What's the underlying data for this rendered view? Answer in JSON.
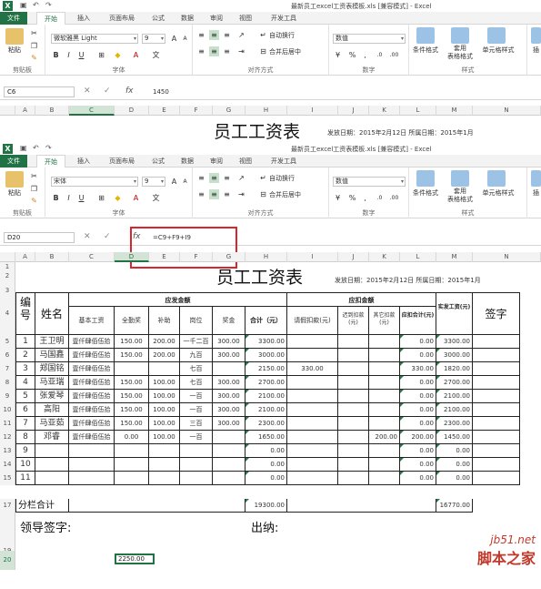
{
  "window": {
    "title": "最新员工excel工资表模板.xls  [兼容模式] - Excel",
    "app_icon": "X"
  },
  "tabs": [
    "文件",
    "开始",
    "插入",
    "页面布局",
    "公式",
    "数据",
    "审阅",
    "视图",
    "开发工具"
  ],
  "ribbon": {
    "paste_label": "粘贴",
    "clipboard_group": "剪贴板",
    "font_name_top": "微软雅黑 Light",
    "font_name_bottom": "宋体",
    "font_size": "9",
    "font_group": "字体",
    "align_group": "对齐方式",
    "wrap_text": "自动换行",
    "merge_center": "合并后居中",
    "number_format": "数值",
    "number_group": "数字",
    "cond_format": "条件格式",
    "table_format": "套用\n表格格式",
    "cell_style": "单元格样式",
    "insert_label": "插",
    "styles_group": "样式",
    "bold": "B",
    "italic": "I",
    "underline": "U",
    "font_letter": "A",
    "percent": "%",
    "thousands": ","
  },
  "formula_bar_top": {
    "name_box": "C6",
    "formula": "1450"
  },
  "formula_bar_bottom": {
    "name_box": "D20",
    "formula": "=C9+F9+I9"
  },
  "columns": [
    "A",
    "B",
    "C",
    "D",
    "E",
    "F",
    "G",
    "H",
    "I",
    "J",
    "K",
    "L",
    "M",
    "N"
  ],
  "sheet": {
    "title": "员工工资表",
    "date_line": "发放日期：2015年2月12日 所属日期：2015年1月",
    "hdr_no": "编号",
    "hdr_name": "姓名",
    "hdr_due": "应发金额",
    "hdr_deduct": "应扣金额",
    "hdr_net": "实发工资(元)",
    "hdr_sign": "签字",
    "sub": [
      "基本工资",
      "全勤奖",
      "补助",
      "岗位",
      "奖金",
      "合计（元）",
      "请假扣款(元)",
      "迟到扣款(元)",
      "其它扣款(元)",
      "应扣合计(元)"
    ],
    "rows": [
      {
        "row": "5",
        "no": "1",
        "name": "王卫明",
        "basic": "壹仟肆佰伍拾",
        "full": "150.00",
        "sub": "200.00",
        "post": "一千二百",
        "bonus": "300.00",
        "total": "3300.00",
        "leave": "",
        "late": "",
        "other": "",
        "ded": "0.00",
        "net": "3300.00"
      },
      {
        "row": "6",
        "no": "2",
        "name": "马国鑫",
        "basic": "壹仟肆佰伍拾",
        "full": "150.00",
        "sub": "200.00",
        "post": "九百",
        "bonus": "300.00",
        "total": "3000.00",
        "leave": "",
        "late": "",
        "other": "",
        "ded": "0.00",
        "net": "3000.00"
      },
      {
        "row": "7",
        "no": "3",
        "name": "郑国铭",
        "basic": "壹仟肆佰伍拾",
        "full": "",
        "sub": "",
        "post": "七百",
        "bonus": "",
        "total": "2150.00",
        "leave": "330.00",
        "late": "",
        "other": "",
        "ded": "330.00",
        "net": "1820.00"
      },
      {
        "row": "8",
        "no": "4",
        "name": "马亚瑞",
        "basic": "壹仟肆佰伍拾",
        "full": "150.00",
        "sub": "100.00",
        "post": "七百",
        "bonus": "300.00",
        "total": "2700.00",
        "leave": "",
        "late": "",
        "other": "",
        "ded": "0.00",
        "net": "2700.00"
      },
      {
        "row": "9",
        "no": "5",
        "name": "张爱琴",
        "basic": "壹仟肆佰伍拾",
        "full": "150.00",
        "sub": "100.00",
        "post": "一百",
        "bonus": "300.00",
        "total": "2100.00",
        "leave": "",
        "late": "",
        "other": "",
        "ded": "0.00",
        "net": "2100.00"
      },
      {
        "row": "10",
        "no": "6",
        "name": "高阳",
        "basic": "壹仟肆佰伍拾",
        "full": "150.00",
        "sub": "100.00",
        "post": "一百",
        "bonus": "300.00",
        "total": "2100.00",
        "leave": "",
        "late": "",
        "other": "",
        "ded": "0.00",
        "net": "2100.00"
      },
      {
        "row": "11",
        "no": "7",
        "name": "马亚茹",
        "basic": "壹仟肆佰伍拾",
        "full": "150.00",
        "sub": "100.00",
        "post": "三百",
        "bonus": "300.00",
        "total": "2300.00",
        "leave": "",
        "late": "",
        "other": "",
        "ded": "0.00",
        "net": "2300.00"
      },
      {
        "row": "12",
        "no": "8",
        "name": "邓睿",
        "basic": "壹仟肆佰伍拾",
        "full": "0.00",
        "sub": "100.00",
        "post": "一百",
        "bonus": "",
        "total": "1650.00",
        "leave": "",
        "late": "",
        "other": "200.00",
        "ded": "200.00",
        "net": "1450.00"
      },
      {
        "row": "13",
        "no": "9",
        "name": "",
        "basic": "",
        "full": "",
        "sub": "",
        "post": "",
        "bonus": "",
        "total": "0.00",
        "leave": "",
        "late": "",
        "other": "",
        "ded": "0.00",
        "net": "0.00"
      },
      {
        "row": "14",
        "no": "10",
        "name": "",
        "basic": "",
        "full": "",
        "sub": "",
        "post": "",
        "bonus": "",
        "total": "0.00",
        "leave": "",
        "late": "",
        "other": "",
        "ded": "0.00",
        "net": "0.00"
      },
      {
        "row": "15",
        "no": "11",
        "name": "",
        "basic": "",
        "full": "",
        "sub": "",
        "post": "",
        "bonus": "",
        "total": "0.00",
        "leave": "",
        "late": "",
        "other": "",
        "ded": "0.00",
        "net": "0.00"
      }
    ],
    "subtotal_row": "17",
    "subtotal_label": "分栏合计",
    "subtotal_total": "19300.00",
    "subtotal_net": "16770.00",
    "sig_leader": "领导签字:",
    "sig_cashier": "出纳:",
    "row_labels": {
      "r1": "1",
      "r2": "2",
      "r3": "3",
      "r4": "4",
      "r19": "19",
      "r20": "20"
    },
    "cell_d20": "2250.00"
  },
  "watermark": {
    "site": "jb51.net",
    "name": "脚本之家"
  }
}
